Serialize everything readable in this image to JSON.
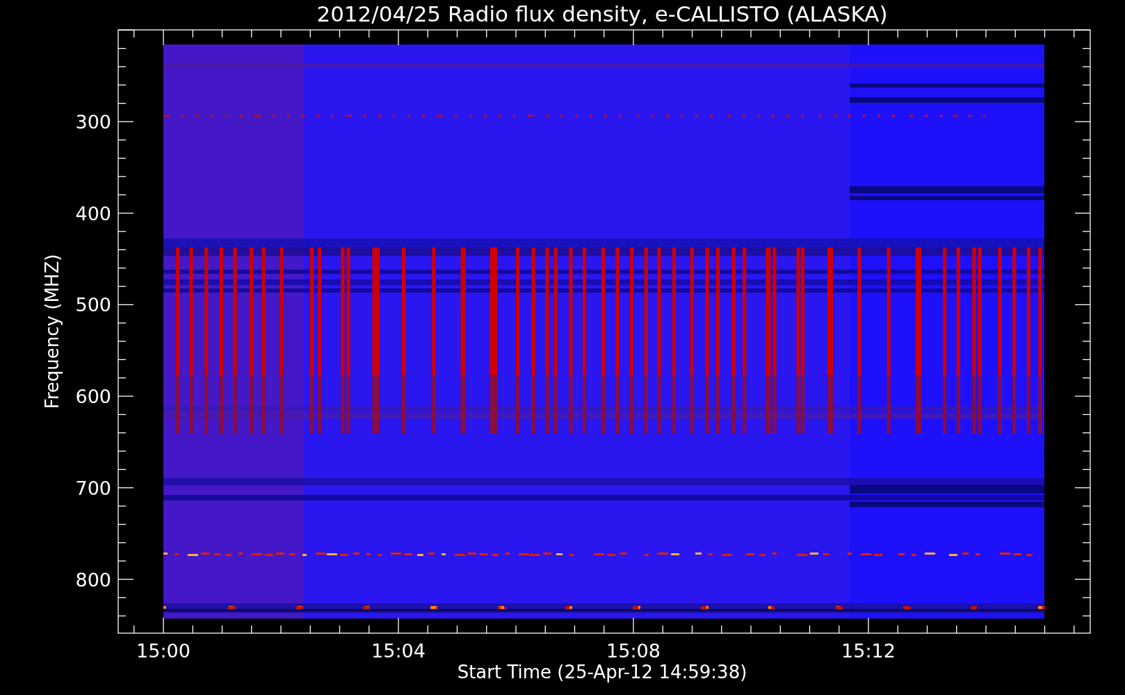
{
  "title": "2012/04/25  Radio flux density, e-CALLISTO (ALASKA)",
  "ylabel": "Frequency (MHZ)",
  "xlabel": "Start Time (25-Apr-12 14:59:38)",
  "yticks": [
    "300",
    "400",
    "500",
    "600",
    "700",
    "800"
  ],
  "xticks": [
    "15:00",
    "15:04",
    "15:08",
    "15:12"
  ]
}
